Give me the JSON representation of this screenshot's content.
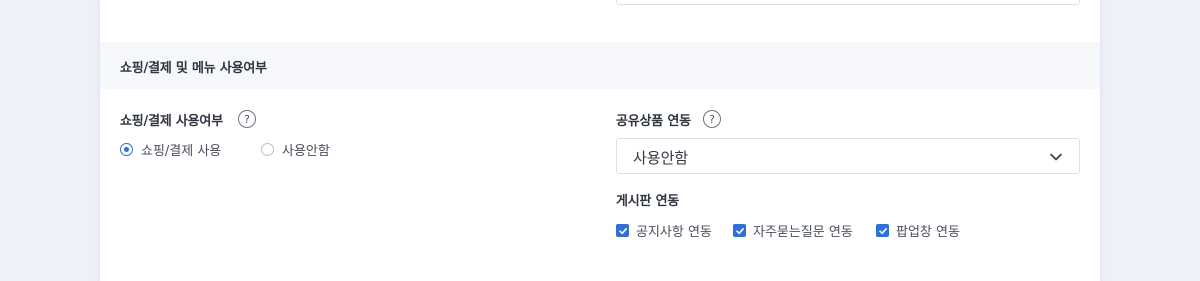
{
  "section": {
    "title": "쇼핑/결제 및 메뉴 사용여부"
  },
  "shopping": {
    "label": "쇼핑/결제 사용여부",
    "help_glyph": "?",
    "options": [
      {
        "label": "쇼핑/결제 사용",
        "checked": true
      },
      {
        "label": "사용안함",
        "checked": false
      }
    ]
  },
  "shared_product": {
    "label": "공유상품 연동",
    "help_glyph": "?",
    "selected": "사용안함"
  },
  "board": {
    "label": "게시판 연동",
    "options": [
      {
        "label": "공지사항 연동",
        "checked": true
      },
      {
        "label": "자주묻는질문 연동",
        "checked": true
      },
      {
        "label": "팝업창 연동",
        "checked": true
      }
    ]
  },
  "colors": {
    "accent": "#2f6fd6",
    "background": "#eef1f9",
    "section_bg": "#f6f7fb"
  }
}
